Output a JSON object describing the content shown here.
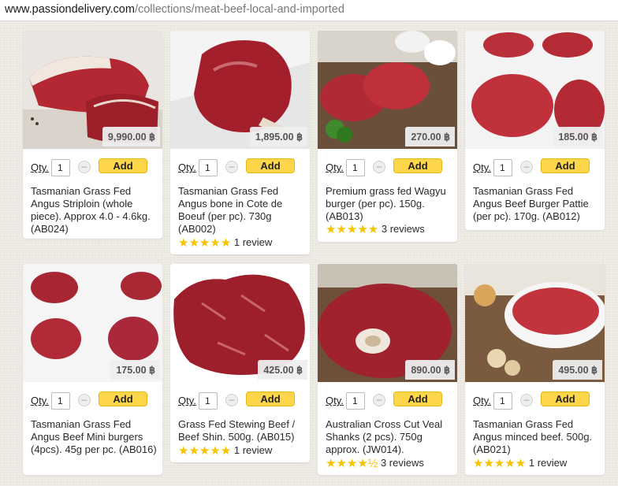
{
  "address_bar": {
    "host": "www.passiondelivery.com",
    "path": "/collections/meat-beef-local-and-imported"
  },
  "labels": {
    "qty": "Qty.",
    "add": "Add",
    "minus": "–"
  },
  "products": [
    {
      "price": "9,990.00 ฿",
      "qty": "1",
      "title": "Tasmanian Grass Fed Angus Striploin (whole piece). Approx 4.0 - 4.6kg. (AB024)",
      "stars": "",
      "reviews": ""
    },
    {
      "price": "1,895.00 ฿",
      "qty": "1",
      "title": "Tasmanian Grass Fed Angus bone in Cote de Boeuf (per pc). 730g (AB002)",
      "stars": "★★★★★",
      "reviews": "1 review"
    },
    {
      "price": "270.00 ฿",
      "qty": "1",
      "title": "Premium grass fed Wagyu burger (per pc). 150g. (AB013)",
      "stars": "★★★★★",
      "reviews": "3 reviews"
    },
    {
      "price": "185.00 ฿",
      "qty": "1",
      "title": "Tasmanian Grass Fed Angus Beef Burger Pattie (per pc). 170g. (AB012)",
      "stars": "",
      "reviews": ""
    },
    {
      "price": "175.00 ฿",
      "qty": "1",
      "title": "Tasmanian Grass Fed Angus Beef Mini burgers (4pcs). 45g per pc. (AB016)",
      "stars": "",
      "reviews": ""
    },
    {
      "price": "425.00 ฿",
      "qty": "1",
      "title": "Grass Fed Stewing Beef / Beef Shin. 500g. (AB015)",
      "stars": "★★★★★",
      "reviews": "1 review"
    },
    {
      "price": "890.00 ฿",
      "qty": "1",
      "title": "Australian Cross Cut Veal Shanks (2 pcs). 750g approx. (JW014).",
      "stars": "★★★★½",
      "reviews": "3 reviews"
    },
    {
      "price": "495.00 ฿",
      "qty": "1",
      "title": "Tasmanian Grass Fed Angus minced beef. 500g. (AB021)",
      "stars": "★★★★★",
      "reviews": "1 review"
    }
  ],
  "colors": {
    "add_button": "#ffd64a",
    "stars": "#f5c400",
    "meat": "#a3202c"
  }
}
